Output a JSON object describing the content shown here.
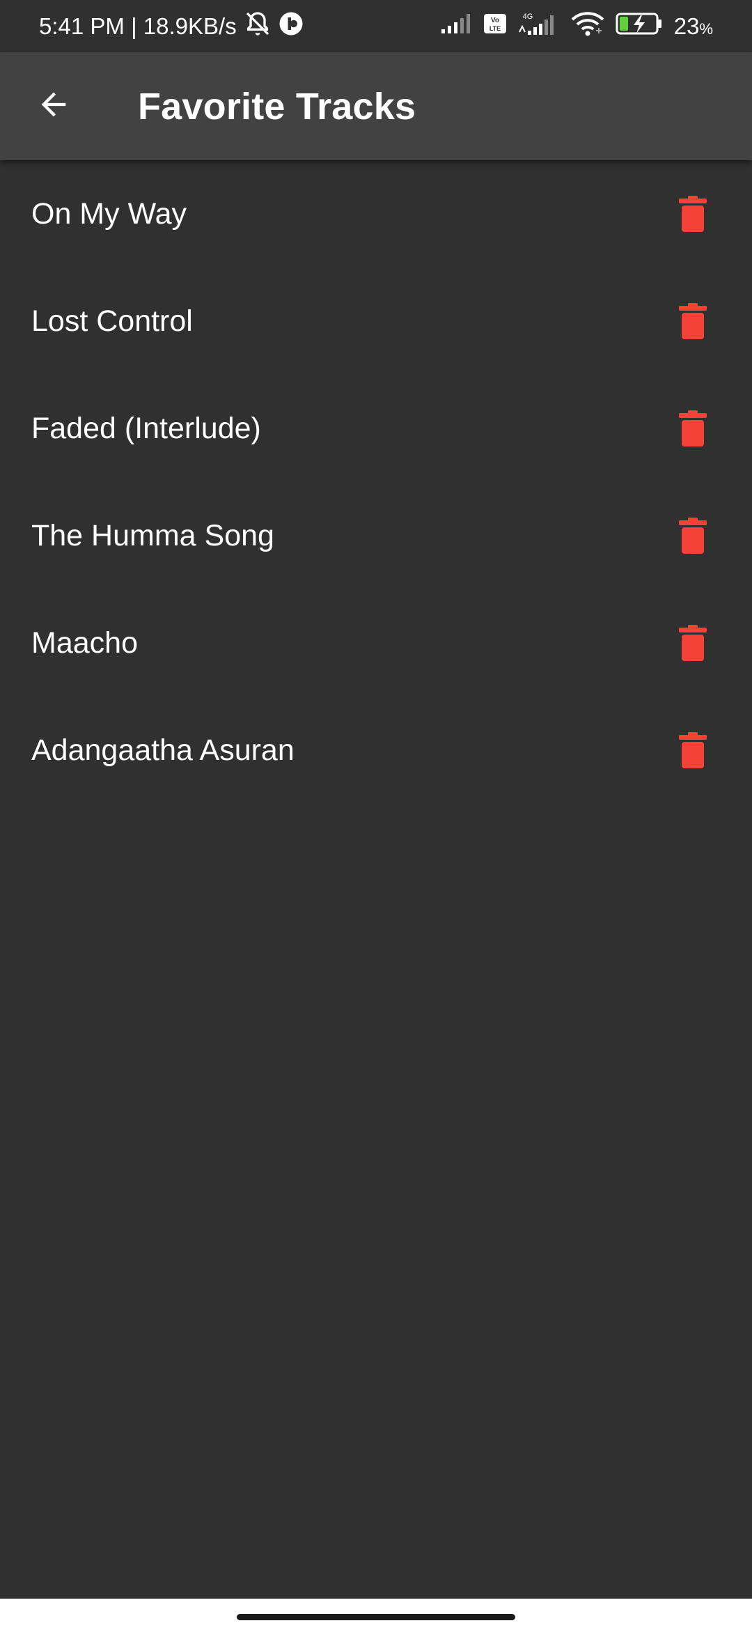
{
  "status_bar": {
    "time_speed": "5:41 PM | 18.9KB/s",
    "volte_label": "Vo LTE",
    "network_label": "4G",
    "battery_percent": "23",
    "battery_percent_sign": "%"
  },
  "header": {
    "title": "Favorite Tracks",
    "back_icon": "arrow-left-icon"
  },
  "tracks": [
    {
      "title": "On My Way"
    },
    {
      "title": "Lost Control"
    },
    {
      "title": "Faded (Interlude)"
    },
    {
      "title": "The Humma Song"
    },
    {
      "title": "Maacho"
    },
    {
      "title": "Adangaatha Asuran"
    }
  ],
  "colors": {
    "background": "#303030",
    "app_bar": "#424242",
    "delete_icon": "#F44336",
    "text": "#FFFFFF"
  }
}
